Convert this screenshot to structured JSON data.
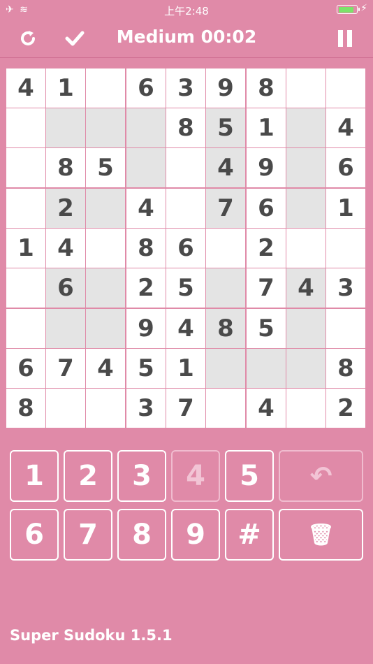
{
  "status_bar": {
    "time": "上午2:48",
    "left_icons": "✈ ≋",
    "charge_icon": "⚡",
    "battery_level": 0.9,
    "battery_color": "#7be36a"
  },
  "nav": {
    "title": "Medium 00:02",
    "restart_icon": "↻",
    "check_icon": "✓",
    "pause_icon": "❚❚"
  },
  "board": {
    "cells": [
      [
        "4",
        "1",
        "",
        "6",
        "3",
        "9",
        "8",
        "",
        ""
      ],
      [
        "",
        "",
        "",
        "",
        "8",
        "5",
        "1",
        "",
        "4"
      ],
      [
        "",
        "8",
        "5",
        "",
        "",
        "4",
        "9",
        "",
        "6"
      ],
      [
        "",
        "2",
        "",
        "4",
        "",
        "7",
        "6",
        "",
        "1"
      ],
      [
        "1",
        "4",
        "",
        "8",
        "6",
        "",
        "2",
        "",
        ""
      ],
      [
        "",
        "6",
        "",
        "2",
        "5",
        "",
        "7",
        "4",
        "3"
      ],
      [
        "",
        "",
        "",
        "9",
        "4",
        "8",
        "5",
        "",
        ""
      ],
      [
        "6",
        "7",
        "4",
        "5",
        "1",
        "",
        "",
        "",
        "8"
      ],
      [
        "8",
        "",
        "",
        "3",
        "7",
        "",
        "4",
        "",
        "2"
      ]
    ],
    "highlighted": [
      [
        1,
        1
      ],
      [
        1,
        2
      ],
      [
        1,
        3
      ],
      [
        1,
        5
      ],
      [
        1,
        7
      ],
      [
        2,
        3
      ],
      [
        2,
        5
      ],
      [
        2,
        7
      ],
      [
        3,
        1
      ],
      [
        3,
        2
      ],
      [
        3,
        5
      ],
      [
        3,
        7
      ],
      [
        5,
        1
      ],
      [
        5,
        2
      ],
      [
        5,
        5
      ],
      [
        5,
        7
      ],
      [
        6,
        1
      ],
      [
        6,
        2
      ],
      [
        6,
        5
      ],
      [
        6,
        7
      ],
      [
        7,
        5
      ],
      [
        7,
        6
      ],
      [
        7,
        7
      ]
    ],
    "highlight_color": "#e4e4e4"
  },
  "keypad": {
    "keys": [
      {
        "label": "1",
        "disabled": false
      },
      {
        "label": "2",
        "disabled": false
      },
      {
        "label": "3",
        "disabled": false
      },
      {
        "label": "4",
        "disabled": true
      },
      {
        "label": "5",
        "disabled": false
      },
      {
        "label": "↶",
        "disabled": true,
        "name": "undo-button"
      },
      {
        "label": "6",
        "disabled": false
      },
      {
        "label": "7",
        "disabled": false
      },
      {
        "label": "8",
        "disabled": false
      },
      {
        "label": "9",
        "disabled": false
      },
      {
        "label": "#",
        "disabled": false,
        "name": "notes-button"
      },
      {
        "label": "🗑",
        "disabled": false,
        "name": "delete-button"
      }
    ]
  },
  "footer": {
    "version": "Super Sudoku 1.5.1"
  },
  "colors": {
    "background": "#e08aa8",
    "digit": "#4a4a4a"
  }
}
